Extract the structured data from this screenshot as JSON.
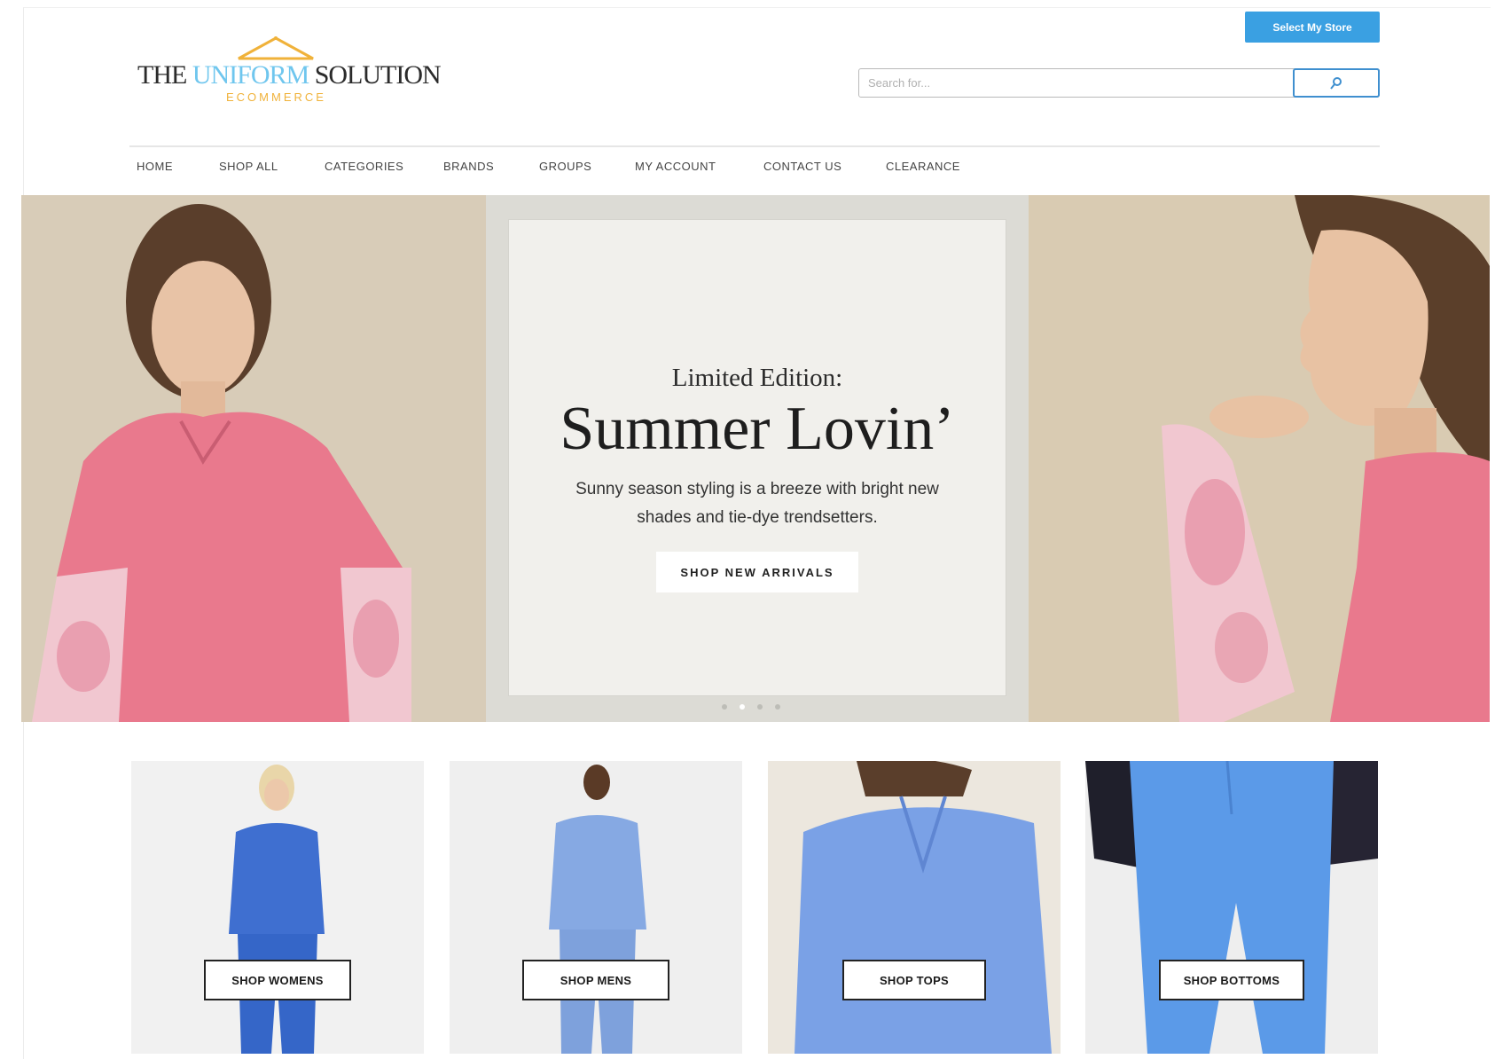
{
  "header": {
    "logo": {
      "part1": "THE ",
      "part2": "UNIFORM",
      "part3": " SOLUTION",
      "subtitle": "ECOMMERCE"
    },
    "select_store_label": "Select My Store",
    "search": {
      "placeholder": "Search for...",
      "value": "",
      "icon": "search-icon"
    }
  },
  "nav": {
    "items": [
      {
        "label": "HOME"
      },
      {
        "label": "SHOP ALL"
      },
      {
        "label": "CATEGORIES"
      },
      {
        "label": "BRANDS"
      },
      {
        "label": "GROUPS"
      },
      {
        "label": "MY ACCOUNT"
      },
      {
        "label": "CONTACT US"
      },
      {
        "label": "CLEARANCE"
      }
    ]
  },
  "hero": {
    "eyebrow": "Limited Edition:",
    "title": "Summer Lovin’",
    "description": "Sunny season styling is a breeze with bright new shades and tie-dye trendsetters.",
    "cta_label": "SHOP NEW ARRIVALS",
    "slide_count": 4,
    "active_slide": 2
  },
  "categories": [
    {
      "label": "SHOP WOMENS"
    },
    {
      "label": "SHOP MENS"
    },
    {
      "label": "SHOP TOPS"
    },
    {
      "label": "SHOP BOTTOMS"
    }
  ],
  "colors": {
    "accent": "#3aa0e2",
    "logo_blue": "#6fc6ee",
    "logo_gold": "#f0b23a",
    "scrub_pink": "#e9798d",
    "scrub_blue": "#3f6fd0"
  }
}
